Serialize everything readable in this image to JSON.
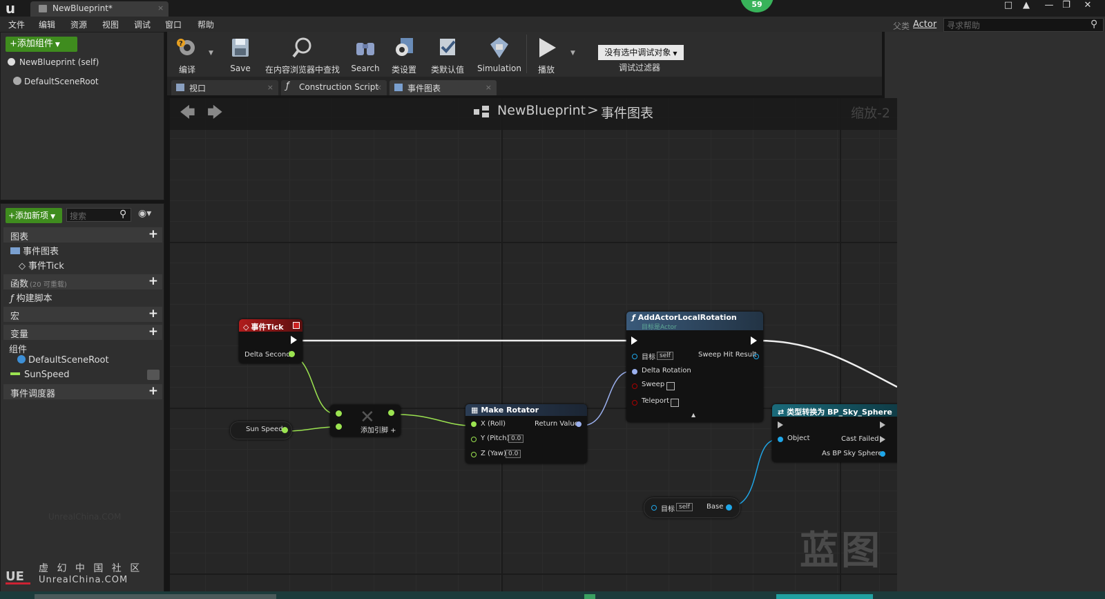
{
  "window": {
    "tab_title": "NewBlueprint*",
    "fps": "59",
    "close_x": "×"
  },
  "menu": [
    "文件",
    "编辑",
    "资源",
    "视图",
    "调试",
    "窗口",
    "帮助"
  ],
  "parent_class": {
    "label": "父类",
    "value": "Actor"
  },
  "help_search": {
    "placeholder": "寻求帮助"
  },
  "components": {
    "add_label": "+添加组件",
    "items": [
      "NewBlueprint (self)",
      "DefaultSceneRoot"
    ]
  },
  "my_blueprint": {
    "add_new_label": "+添加新项",
    "search_placeholder": "搜索",
    "cat_graphs": "图表",
    "event_graph": "事件图表",
    "event_tick": "事件Tick",
    "cat_functions": "函数",
    "functions_note": "(20 可重载)",
    "construction_script": "构建脚本",
    "cat_macros": "宏",
    "cat_variables": "变量",
    "cat_components": "组件",
    "comp_default_root": "DefaultSceneRoot",
    "var_sun_speed": "SunSpeed",
    "cat_dispatchers": "事件调度器"
  },
  "toolbar": {
    "compile": "编译",
    "save": "Save",
    "find_in_cb": "在内容浏览器中查找",
    "search": "Search",
    "class_settings": "类设置",
    "class_defaults": "类默认值",
    "simulation": "Simulation",
    "play": "播放",
    "debug_object": "没有选中调试对象",
    "debug_filter": "调试过滤器"
  },
  "tabs": [
    "视口",
    "Construction Script",
    "事件图表"
  ],
  "graph": {
    "breadcrumb_bp": "NewBlueprint",
    "breadcrumb_sep": ">",
    "breadcrumb_graph": "事件图表",
    "zoom": "缩放-2",
    "watermark": "蓝图",
    "footer_watermark": "UnrealChina.COM"
  },
  "nodes": {
    "event_tick": {
      "title": "事件Tick",
      "pin_delta": "Delta Seconds"
    },
    "sun_speed": {
      "label": "Sun Speed"
    },
    "multiply": {
      "add_pin": "添加引脚 +"
    },
    "make_rotator": {
      "title": "Make Rotator",
      "x": "X (Roll)",
      "y": "Y (Pitch)",
      "z": "Z (Yaw)",
      "y_val": "0.0",
      "z_val": "0.0",
      "ret": "Return Value"
    },
    "add_rot": {
      "title": "AddActorLocalRotation",
      "subtitle": "目标是Actor",
      "target": "目标",
      "self": "self",
      "sweep_hit": "Sweep Hit Result",
      "delta_rot": "Delta Rotation",
      "sweep": "Sweep",
      "teleport": "Teleport"
    },
    "cast": {
      "title": "类型转换为 BP_Sky_Sphere",
      "object": "Object",
      "failed": "Cast Failed",
      "as": "As BP Sky Sphere"
    },
    "get_base": {
      "target": "目标",
      "self": "self",
      "base": "Base"
    }
  },
  "branding": {
    "logo": "虚 幻 中 国 社 区",
    "url": "UnrealChina.COM"
  },
  "colors": {
    "accent_green": "#3f8c1e",
    "exec_white": "#ffffff",
    "float_green": "#9be350",
    "struct_blue": "#5b8fd8",
    "event_red": "#9c1c1c"
  }
}
